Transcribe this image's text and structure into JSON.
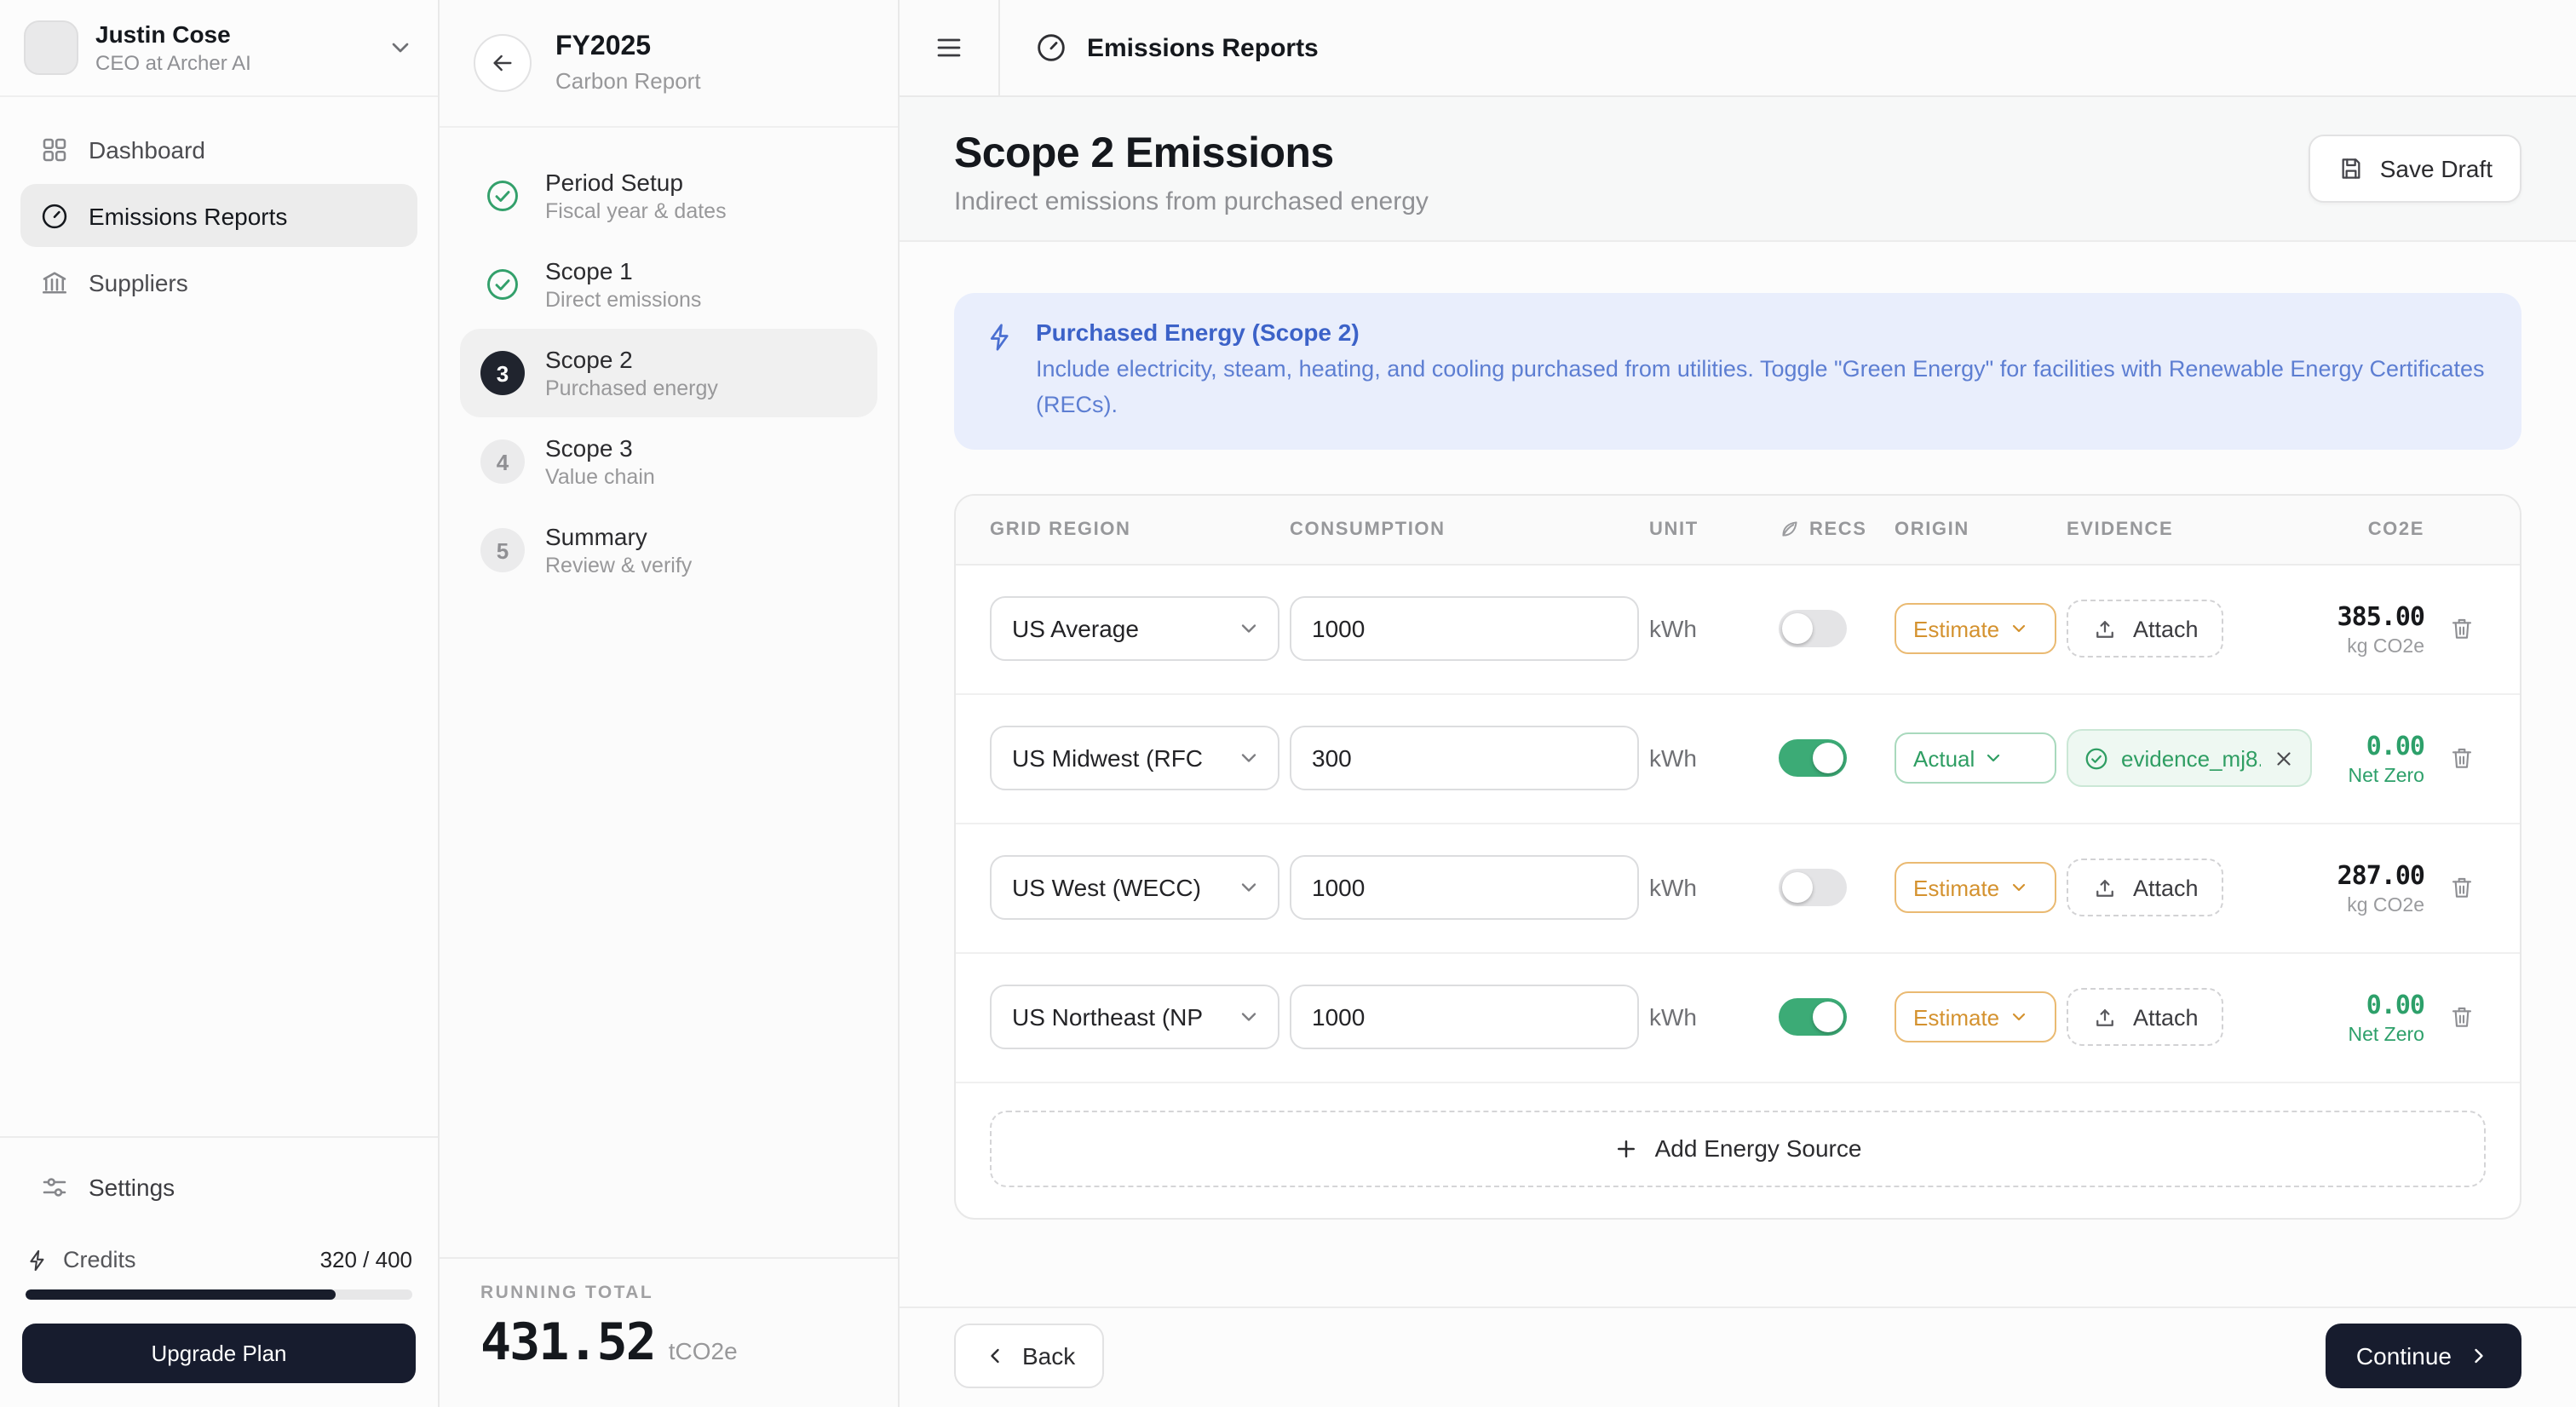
{
  "user": {
    "name": "Justin Cose",
    "role": "CEO at Archer AI"
  },
  "sidebar": {
    "items": [
      {
        "label": "Dashboard"
      },
      {
        "label": "Emissions Reports"
      },
      {
        "label": "Suppliers"
      }
    ],
    "settings_label": "Settings",
    "credits": {
      "label": "Credits",
      "value": "320 / 400",
      "percent": 80
    },
    "upgrade_label": "Upgrade Plan"
  },
  "topbar": {
    "title": "Emissions Reports"
  },
  "wizard": {
    "title": "FY2025",
    "subtitle": "Carbon Report",
    "steps": [
      {
        "num": "1",
        "label": "Period Setup",
        "sub": "Fiscal year & dates",
        "state": "done"
      },
      {
        "num": "2",
        "label": "Scope 1",
        "sub": "Direct emissions",
        "state": "done"
      },
      {
        "num": "3",
        "label": "Scope 2",
        "sub": "Purchased energy",
        "state": "active"
      },
      {
        "num": "4",
        "label": "Scope 3",
        "sub": "Value chain",
        "state": "todo"
      },
      {
        "num": "5",
        "label": "Summary",
        "sub": "Review & verify",
        "state": "todo"
      }
    ],
    "running_total": {
      "label": "RUNNING TOTAL",
      "value": "431.52",
      "unit": "tCO2e"
    }
  },
  "main": {
    "title": "Scope 2 Emissions",
    "subtitle": "Indirect emissions from purchased energy",
    "save_draft_label": "Save Draft",
    "banner": {
      "title": "Purchased Energy (Scope 2)",
      "body": "Include electricity, steam, heating, and cooling purchased from utilities. Toggle \"Green Energy\" for facilities with Renewable Energy Certificates (RECs)."
    },
    "table": {
      "headers": {
        "region": "Grid Region",
        "consumption": "Consumption",
        "unit": "Unit",
        "recs": "RECS",
        "origin": "Origin",
        "evidence": "Evidence",
        "co2e": "CO2E"
      },
      "rows": [
        {
          "region": "US Average",
          "consumption": "1000",
          "unit": "kWh",
          "recs": false,
          "origin": "Estimate",
          "evidence_label": "Attach",
          "co2e": "385.00",
          "co2e_note": "kg CO2e",
          "net_zero": false
        },
        {
          "region": "US Midwest (RFC",
          "consumption": "300",
          "unit": "kWh",
          "recs": true,
          "origin": "Actual",
          "evidence_file": "evidence_mj8...",
          "co2e": "0.00",
          "co2e_note": "Net Zero",
          "net_zero": true
        },
        {
          "region": "US West (WECC)",
          "consumption": "1000",
          "unit": "kWh",
          "recs": false,
          "origin": "Estimate",
          "evidence_label": "Attach",
          "co2e": "287.00",
          "co2e_note": "kg CO2e",
          "net_zero": false
        },
        {
          "region": "US Northeast (NP",
          "consumption": "1000",
          "unit": "kWh",
          "recs": true,
          "origin": "Estimate",
          "evidence_label": "Attach",
          "co2e": "0.00",
          "co2e_note": "Net Zero",
          "net_zero": true
        }
      ],
      "add_label": "Add Energy Source"
    },
    "footer": {
      "back_label": "Back",
      "continue_label": "Continue"
    }
  },
  "icons": {
    "dashboard": "grid-icon",
    "emissions": "gauge-icon",
    "suppliers": "building-icon",
    "settings": "sliders-icon",
    "credits": "bolt-icon",
    "banner": "bolt-icon",
    "recs": "leaf-icon",
    "evidence_attach": "upload-icon",
    "evidence_ok": "check-circle-icon",
    "delete": "trash-icon",
    "save": "floppy-icon"
  },
  "colors": {
    "accent_dark": "#171c2e",
    "green": "#3cab76",
    "green_text": "#2f9e63",
    "amber": "#d4922f",
    "banner_bg": "#e9eefc",
    "banner_text": "#5d7ed2"
  }
}
